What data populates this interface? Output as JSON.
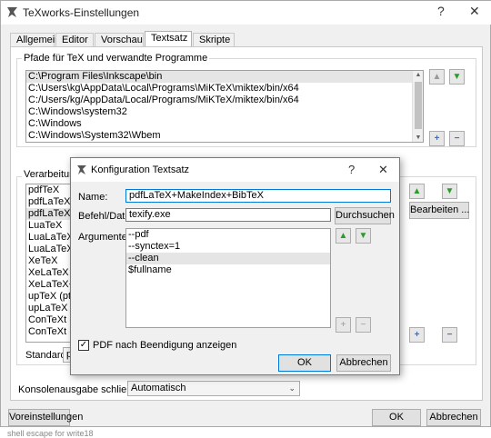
{
  "window": {
    "title": "TeXworks-Einstellungen",
    "help_glyph": "?",
    "close_glyph": "✕",
    "app_icon": "texworks-lion-icon"
  },
  "tabs": [
    {
      "label": "Allgemein"
    },
    {
      "label": "Editor"
    },
    {
      "label": "Vorschau"
    },
    {
      "label": "Textsatz",
      "active": true
    },
    {
      "label": "Skripte"
    }
  ],
  "paths": {
    "group_label": "Pfade für TeX und verwandte Programme",
    "items": [
      "C:\\Program Files\\Inkscape\\bin",
      "C:\\Users\\kg\\AppData\\Local\\Programs\\MiKTeX\\miktex/bin/x64",
      "C:/Users/kg/AppData/Local/Programs/MiKTeX/miktex/bin/x64",
      "C:\\Windows\\system32",
      "C:\\Windows",
      "C:\\Windows\\System32\\Wbem"
    ],
    "selected_index": 0
  },
  "engines": {
    "group_label": "Verarbeitungs",
    "items": [
      "pdfTeX",
      "pdfLaTeX",
      "pdfLaTeX+M",
      "LuaTeX",
      "LuaLaTeX",
      "LuaLaTeX+M",
      "XeTeX",
      "XeLaTeX",
      "XeLaTeX+M",
      "upTeX (ptex",
      "upLaTeX (p",
      "ConTeXt (L",
      "ConTeXt (p"
    ],
    "selected_index": 2,
    "edit_button": "Bearbeiten ...",
    "default_label": "Standard:",
    "default_value": "p"
  },
  "console": {
    "label": "Konsolenausgabe schließen:",
    "value": "Automatisch"
  },
  "footer": {
    "defaults_button": "Voreinstellungen",
    "ok_button": "OK",
    "cancel_button": "Abbrechen"
  },
  "dialog": {
    "title": "Konfiguration Textsatz",
    "help_glyph": "?",
    "close_glyph": "✕",
    "name_label": "Name:",
    "name_value": "pdfLaTeX+MakeIndex+BibTeX",
    "command_label": "Befehl/Datei:",
    "command_value": "texify.exe",
    "browse_button": "Durchsuchen",
    "args_label": "Argumente:",
    "args": [
      "--pdf",
      "--synctex=1",
      "--clean",
      "$fullname"
    ],
    "selected_arg_index": 2,
    "checkbox_label": "PDF nach Beendigung anzeigen",
    "checkbox_checked": true,
    "ok_button": "OK",
    "cancel_button": "Abbrechen"
  },
  "icons": {
    "up": "▲",
    "down": "▼",
    "plus": "+",
    "minus": "−",
    "check": "✓",
    "chevron": "⌄"
  },
  "bottom_text": "shell escape for write18"
}
